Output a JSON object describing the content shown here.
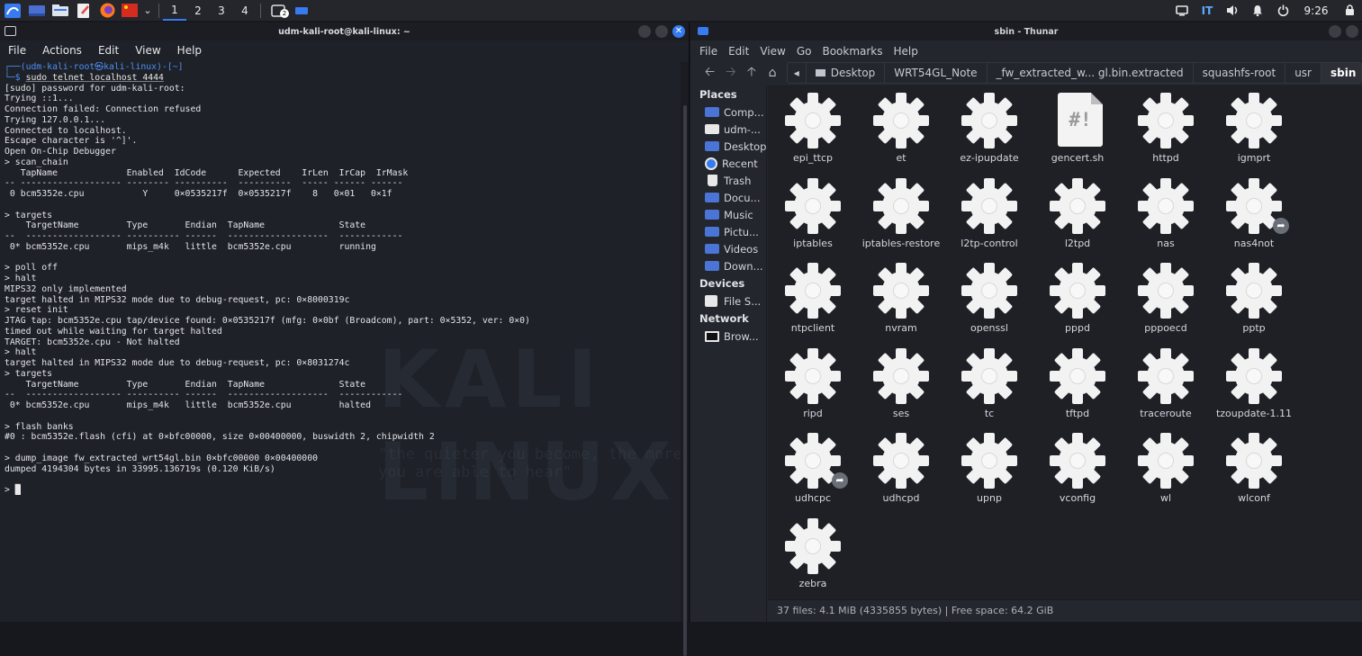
{
  "panel": {
    "workspaces": [
      "1",
      "2",
      "3",
      "4"
    ],
    "active_workspace": 0,
    "keyboard_layout": "IT",
    "clock": "9:26",
    "task_badge": "2"
  },
  "terminal": {
    "title": "udm-kali-root@kali-linux: ~",
    "menu": [
      "File",
      "Actions",
      "Edit",
      "View",
      "Help"
    ],
    "prompt_top": "┌──(udm-kali-root㉿kali-linux)-[~]",
    "prompt_bottom": "└─$ ",
    "prompt_command": "sudo telnet localhost 4444",
    "output": "[sudo] password for udm-kali-root:\nTrying ::1...\nConnection failed: Connection refused\nTrying 127.0.0.1...\nConnected to localhost.\nEscape character is '^]'.\nOpen On-Chip Debugger\n> scan_chain\n   TapName             Enabled  IdCode      Expected    IrLen  IrCap  IrMask\n-- ------------------- -------- ----------  ----------  ----- ------ ------\n 0 bcm5352e.cpu           Y     0×0535217f  0×0535217f    8   0×01   0×1f\n\n> targets\n    TargetName         Type       Endian  TapName              State\n--  ------------------ ---------- ------  -------------------  ------------\n 0* bcm5352e.cpu       mips_m4k   little  bcm5352e.cpu         running\n\n> poll off\n> halt\nMIPS32 only implemented\ntarget halted in MIPS32 mode due to debug-request, pc: 0×8000319c\n> reset init\nJTAG tap: bcm5352e.cpu tap/device found: 0×0535217f (mfg: 0×0bf (Broadcom), part: 0×5352, ver: 0×0)\ntimed out while waiting for target halted\nTARGET: bcm5352e.cpu - Not halted\n> halt\ntarget halted in MIPS32 mode due to debug-request, pc: 0×8031274c\n> targets\n    TargetName         Type       Endian  TapName              State\n--  ------------------ ---------- ------  -------------------  ------------\n 0* bcm5352e.cpu       mips_m4k   little  bcm5352e.cpu         halted\n\n> flash banks\n#0 : bcm5352e.flash (cfi) at 0×bfc00000, size 0×00400000, buswidth 2, chipwidth 2\n\n> dump_image fw_extracted_wrt54gl.bin 0×bfc00000 0×00400000\ndumped 4194304 bytes in 33995.136719s (0.120 KiB/s)\n\n> ",
    "watermark": "KALI LINUX",
    "watermark_quote": "\"the quieter you become, the more you are able to hear\""
  },
  "thunar": {
    "title": "sbin - Thunar",
    "menu": [
      "File",
      "Edit",
      "View",
      "Go",
      "Bookmarks",
      "Help"
    ],
    "breadcrumbs": [
      "Desktop",
      "WRT54GL_Note",
      "_fw_extracted_w... gl.bin.extracted",
      "squashfs-root",
      "usr",
      "sbin"
    ],
    "sidebar": {
      "places_label": "Places",
      "places": [
        "Comp...",
        "udm-...",
        "Desktop",
        "Recent",
        "Trash",
        "Docu...",
        "Music",
        "Pictu...",
        "Videos",
        "Down..."
      ],
      "devices_label": "Devices",
      "devices": [
        "File S..."
      ],
      "network_label": "Network",
      "network": [
        "Brow..."
      ]
    },
    "files": [
      {
        "name": "epi_ttcp",
        "type": "exec"
      },
      {
        "name": "et",
        "type": "exec"
      },
      {
        "name": "ez-ipupdate",
        "type": "exec"
      },
      {
        "name": "gencert.sh",
        "type": "script"
      },
      {
        "name": "httpd",
        "type": "exec"
      },
      {
        "name": "igmprt",
        "type": "exec"
      },
      {
        "name": "iptables",
        "type": "exec"
      },
      {
        "name": "iptables-restore",
        "type": "exec"
      },
      {
        "name": "l2tp-control",
        "type": "exec"
      },
      {
        "name": "l2tpd",
        "type": "exec"
      },
      {
        "name": "nas",
        "type": "exec"
      },
      {
        "name": "nas4not",
        "type": "link"
      },
      {
        "name": "ntpclient",
        "type": "exec"
      },
      {
        "name": "nvram",
        "type": "exec"
      },
      {
        "name": "openssl",
        "type": "exec"
      },
      {
        "name": "pppd",
        "type": "exec"
      },
      {
        "name": "pppoecd",
        "type": "exec"
      },
      {
        "name": "pptp",
        "type": "exec"
      },
      {
        "name": "ripd",
        "type": "exec"
      },
      {
        "name": "ses",
        "type": "exec"
      },
      {
        "name": "tc",
        "type": "exec"
      },
      {
        "name": "tftpd",
        "type": "exec"
      },
      {
        "name": "traceroute",
        "type": "exec"
      },
      {
        "name": "tzoupdate-1.11",
        "type": "exec"
      },
      {
        "name": "udhcpc",
        "type": "link"
      },
      {
        "name": "udhcpd",
        "type": "exec"
      },
      {
        "name": "upnp",
        "type": "exec"
      },
      {
        "name": "vconfig",
        "type": "exec"
      },
      {
        "name": "wl",
        "type": "exec"
      },
      {
        "name": "wlconf",
        "type": "exec"
      },
      {
        "name": "zebra",
        "type": "exec"
      }
    ],
    "status": "37 files: 4.1 MiB (4335855 bytes)  |  Free space: 64.2 GiB"
  }
}
